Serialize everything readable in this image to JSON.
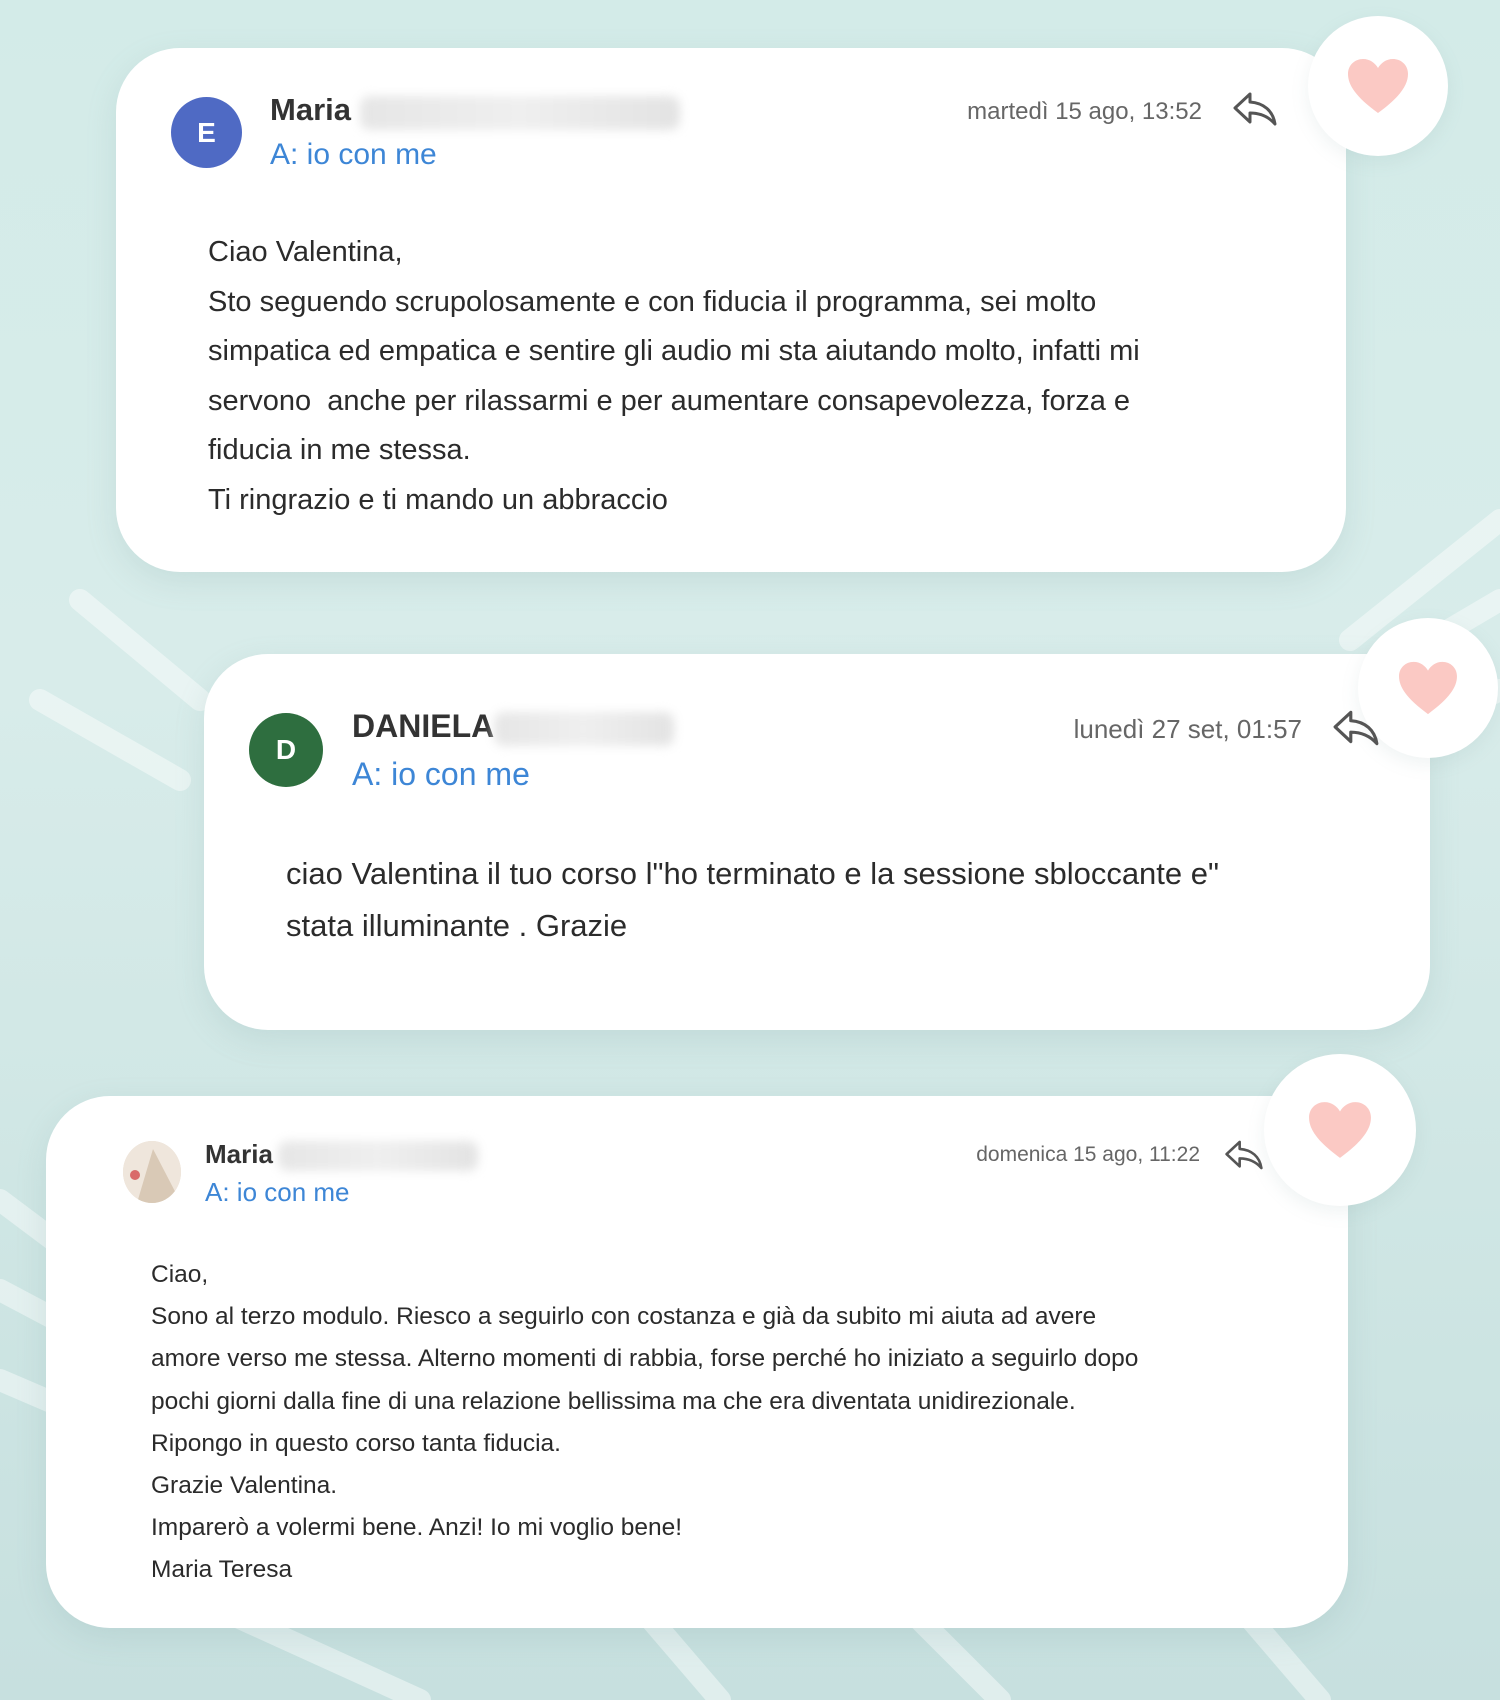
{
  "messages": [
    {
      "avatar_letter": "E",
      "avatar_color": "#4f6ac4",
      "sender_first_name": "Maria",
      "recipient": "A: io con me",
      "date": "martedì 15 ago, 13:52",
      "body_lines": [
        "Ciao Valentina,",
        "Sto seguendo scrupolosamente e con fiducia il programma, sei molto",
        "simpatica ed empatica e sentire gli audio mi sta aiutando molto, infatti mi",
        "servono  anche per rilassarmi e per aumentare consapevolezza, forza e",
        "fiducia in me stessa.",
        "Ti ringrazio e ti mando un abbraccio"
      ]
    },
    {
      "avatar_letter": "D",
      "avatar_color": "#2e6e3f",
      "sender_first_name": "DANIELA",
      "recipient": "A: io con me",
      "date": "lunedì 27 set, 01:57",
      "body_lines": [
        "ciao Valentina il tuo corso l\"ho terminato e la sessione sbloccante e\"",
        "stata illuminante . Grazie"
      ]
    },
    {
      "avatar_letter": "",
      "avatar_color": "#e9ddd1",
      "sender_first_name": "Maria",
      "recipient": "A: io con me",
      "date": "domenica 15 ago, 11:22",
      "body_lines": [
        "Ciao,",
        "Sono al terzo modulo. Riesco a seguirlo con costanza e già da subito mi aiuta ad avere",
        "amore verso me stessa. Alterno momenti di rabbia, forse perché ho iniziato a seguirlo dopo",
        "pochi giorni dalla fine di una relazione bellissima ma che era diventata unidirezionale.",
        "Ripongo in questo corso tanta fiducia.",
        "Grazie Valentina.",
        "Imparerò a volermi bene. Anzi! Io mi voglio bene!",
        "Maria Teresa"
      ]
    }
  ],
  "colors": {
    "accent_link": "#3d86d6",
    "heart": "#fbc9c4",
    "background": "#d3ebe8"
  },
  "icons": {
    "reply": "reply-arrow-icon",
    "heart": "heart-icon"
  }
}
